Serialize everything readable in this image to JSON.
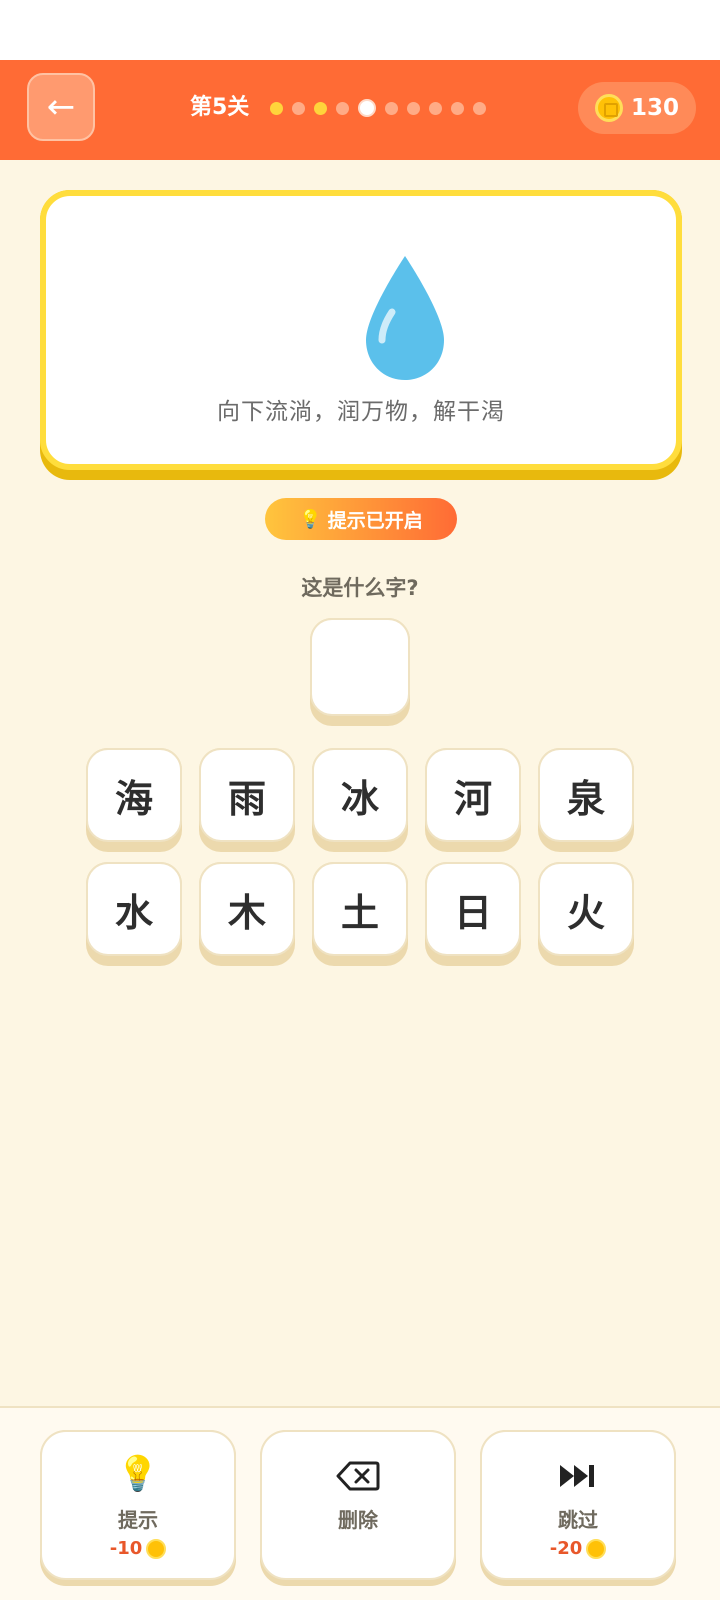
{
  "header": {
    "back_icon": "←",
    "level_title": "第5关",
    "progress": {
      "total": 10,
      "completed": 3,
      "current": 5
    },
    "coins": "130"
  },
  "clue": {
    "icon": "water-drop-icon",
    "text": "向下流淌，润万物，解干渴"
  },
  "hint_badge": "提示已开启",
  "question": "这是什么字?",
  "answer": "",
  "tiles_row1": [
    "海",
    "雨",
    "冰",
    "河",
    "泉"
  ],
  "tiles_row2": [
    "水",
    "木",
    "土",
    "日",
    "火"
  ],
  "actions": {
    "hint": {
      "label": "提示",
      "cost": "-10",
      "icon": "lightbulb-icon"
    },
    "delete": {
      "label": "删除",
      "icon": "backspace-icon"
    },
    "skip": {
      "label": "跳过",
      "cost": "-20",
      "icon": "skip-forward-icon"
    }
  },
  "colors": {
    "header": "#ff6b35",
    "background": "#fdf6e3",
    "card_border": "#ffdd3c",
    "drop": "#5bc0eb"
  }
}
